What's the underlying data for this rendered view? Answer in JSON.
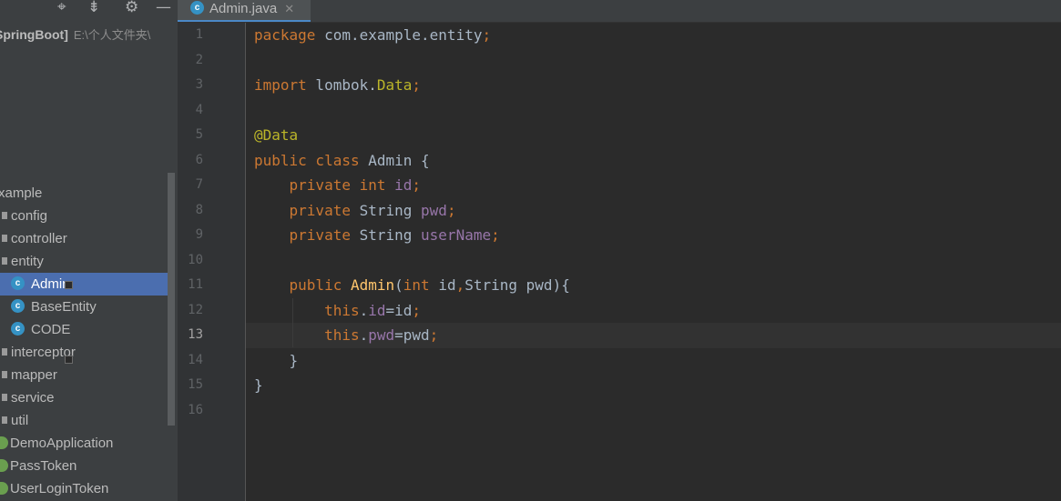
{
  "toolbar_icons": [
    "crosshair-icon",
    "collapse-icon",
    "gear-icon",
    "minimize-icon"
  ],
  "project": {
    "root_name": "SpringBoot]",
    "root_path": "E:\\个人文件夹\\"
  },
  "tree": [
    {
      "kind": "package",
      "label": "xample",
      "selected": false
    },
    {
      "kind": "folder",
      "label": "config",
      "selected": false
    },
    {
      "kind": "folder",
      "label": "controller",
      "selected": false
    },
    {
      "kind": "folder",
      "label": "entity",
      "selected": false
    },
    {
      "kind": "class",
      "label": "Admin",
      "selected": true
    },
    {
      "kind": "class",
      "label": "BaseEntity",
      "selected": false
    },
    {
      "kind": "class",
      "label": "CODE",
      "selected": false
    },
    {
      "kind": "folder",
      "label": "interceptor",
      "selected": false
    },
    {
      "kind": "folder",
      "label": "mapper",
      "selected": false
    },
    {
      "kind": "folder",
      "label": "service",
      "selected": false
    },
    {
      "kind": "folder",
      "label": "util",
      "selected": false
    },
    {
      "kind": "spring",
      "label": "DemoApplication",
      "selected": false
    },
    {
      "kind": "spring",
      "label": "PassToken",
      "selected": false
    },
    {
      "kind": "spring",
      "label": "UserLoginToken",
      "selected": false
    }
  ],
  "editor": {
    "tab": {
      "icon_letter": "c",
      "label": "Admin.java",
      "close": "✕"
    },
    "current_line": 13,
    "lines": [
      [
        [
          "kw",
          "package"
        ],
        [
          "plain",
          " com.example.entity"
        ],
        [
          "kw",
          ";"
        ]
      ],
      [],
      [
        [
          "kw",
          "import"
        ],
        [
          "plain",
          " lombok."
        ],
        [
          "ann",
          "Data"
        ],
        [
          "kw",
          ";"
        ]
      ],
      [],
      [
        [
          "ann",
          "@Data"
        ]
      ],
      [
        [
          "kw",
          "public class"
        ],
        [
          "plain",
          " Admin {"
        ]
      ],
      [
        [
          "plain",
          "    "
        ],
        [
          "kw",
          "private int"
        ],
        [
          "plain",
          " "
        ],
        [
          "fld",
          "id"
        ],
        [
          "kw",
          ";"
        ]
      ],
      [
        [
          "plain",
          "    "
        ],
        [
          "kw",
          "private"
        ],
        [
          "plain",
          " String "
        ],
        [
          "fld",
          "pwd"
        ],
        [
          "kw",
          ";"
        ]
      ],
      [
        [
          "plain",
          "    "
        ],
        [
          "kw",
          "private"
        ],
        [
          "plain",
          " String "
        ],
        [
          "fld",
          "userName"
        ],
        [
          "kw",
          ";"
        ]
      ],
      [],
      [
        [
          "plain",
          "    "
        ],
        [
          "kw",
          "public"
        ],
        [
          "plain",
          " "
        ],
        [
          "fn",
          "Admin"
        ],
        [
          "plain",
          "("
        ],
        [
          "kw",
          "int"
        ],
        [
          "plain",
          " id"
        ],
        [
          "kw",
          ","
        ],
        [
          "plain",
          "String pwd){"
        ]
      ],
      [
        [
          "plain",
          "        "
        ],
        [
          "kw",
          "this"
        ],
        [
          "plain",
          "."
        ],
        [
          "fld",
          "id"
        ],
        [
          "plain",
          "=id"
        ],
        [
          "kw",
          ";"
        ]
      ],
      [
        [
          "plain",
          "        "
        ],
        [
          "kw",
          "this"
        ],
        [
          "plain",
          "."
        ],
        [
          "fld",
          "pwd"
        ],
        [
          "plain",
          "=pwd"
        ],
        [
          "kw",
          ";"
        ]
      ],
      [
        [
          "plain",
          "    }"
        ]
      ],
      [
        [
          "plain",
          "}"
        ]
      ],
      []
    ],
    "line_numbers": [
      "1",
      "2",
      "3",
      "4",
      "5",
      "6",
      "7",
      "8",
      "9",
      "10",
      "11",
      "12",
      "13",
      "14",
      "15",
      "16"
    ]
  },
  "colors": {
    "keyword": "#cc7832",
    "annotation": "#bbb529",
    "field": "#9876aa",
    "method": "#ffc66d",
    "text": "#a9b7c6",
    "selection": "#4b6eaf",
    "class_icon": "#3592c4"
  }
}
